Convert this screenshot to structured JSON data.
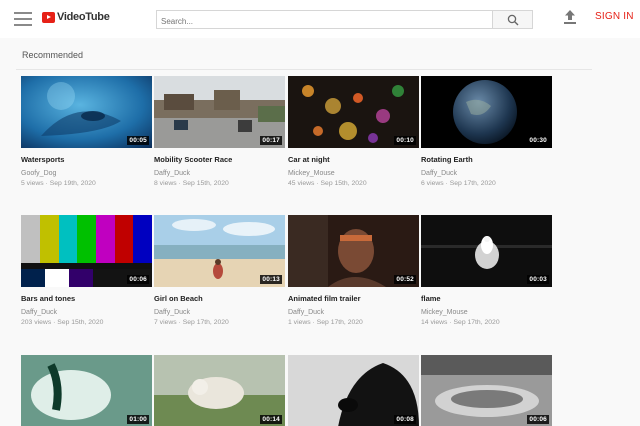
{
  "header": {
    "logo_text": "VideoTube",
    "search_placeholder": "Search...",
    "signin_label": "SIGN IN"
  },
  "section": {
    "title": "Recommended"
  },
  "videos": [
    {
      "title": "Watersports",
      "author": "Goofy_Dog",
      "views": "5 views",
      "date": "Sep 19th, 2020",
      "duration": "00:05"
    },
    {
      "title": "Mobility Scooter Race",
      "author": "Daffy_Duck",
      "views": "8 views",
      "date": "Sep 15th, 2020",
      "duration": "00:17"
    },
    {
      "title": "Car at night",
      "author": "Mickey_Mouse",
      "views": "45 views",
      "date": "Sep 15th, 2020",
      "duration": "00:10"
    },
    {
      "title": "Rotating Earth",
      "author": "Daffy_Duck",
      "views": "6 views",
      "date": "Sep 17th, 2020",
      "duration": "00:30"
    },
    {
      "title": "Bars and tones",
      "author": "Daffy_Duck",
      "views": "203 views",
      "date": "Sep 15th, 2020",
      "duration": "00:06"
    },
    {
      "title": "Girl on Beach",
      "author": "Daffy_Duck",
      "views": "7 views",
      "date": "Sep 17th, 2020",
      "duration": "00:13"
    },
    {
      "title": "Animated film trailer",
      "author": "Daffy_Duck",
      "views": "1 views",
      "date": "Sep 17th, 2020",
      "duration": "00:52"
    },
    {
      "title": "flame",
      "author": "Mickey_Mouse",
      "views": "14 views",
      "date": "Sep 17th, 2020",
      "duration": "00:03"
    },
    {
      "duration": "01:00"
    },
    {
      "duration": "00:14"
    },
    {
      "duration": "00:08"
    },
    {
      "duration": "00:06"
    }
  ],
  "meta_separator": " · ",
  "colors": {
    "brand": "#e62117"
  },
  "icons": {
    "menu": "hamburger-icon",
    "search": "search-icon",
    "upload": "upload-icon",
    "logo": "play-logo-icon"
  }
}
